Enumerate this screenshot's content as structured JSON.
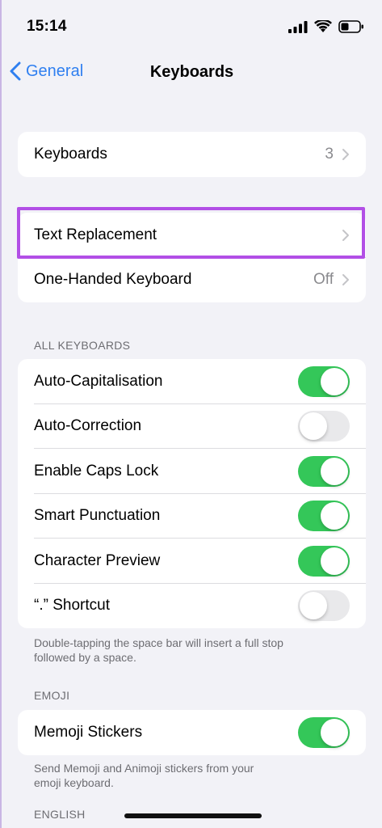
{
  "status": {
    "time": "15:14"
  },
  "nav": {
    "back_label": "General",
    "title": "Keyboards"
  },
  "group1": {
    "keyboards_label": "Keyboards",
    "keyboards_count": "3"
  },
  "group2": {
    "text_replacement_label": "Text Replacement",
    "one_handed_label": "One-Handed Keyboard",
    "one_handed_value": "Off"
  },
  "all_keyboards": {
    "header": "ALL KEYBOARDS",
    "rows": [
      {
        "label": "Auto-Capitalisation",
        "on": true
      },
      {
        "label": "Auto-Correction",
        "on": false
      },
      {
        "label": "Enable Caps Lock",
        "on": true
      },
      {
        "label": "Smart Punctuation",
        "on": true
      },
      {
        "label": "Character Preview",
        "on": true
      },
      {
        "label": "“.” Shortcut",
        "on": false
      }
    ],
    "footer_line1": "Double-tapping the space bar will insert a full stop",
    "footer_line2": "followed by a space."
  },
  "emoji": {
    "header": "EMOJI",
    "memoji_label": "Memoji Stickers",
    "memoji_on": true,
    "footer_line1": "Send Memoji and Animoji stickers from your",
    "footer_line2": "emoji keyboard."
  },
  "english": {
    "header": "ENGLISH"
  },
  "colors": {
    "accent": "#2f7ff0",
    "toggle_on": "#34c759",
    "highlight": "#b24fe6"
  }
}
